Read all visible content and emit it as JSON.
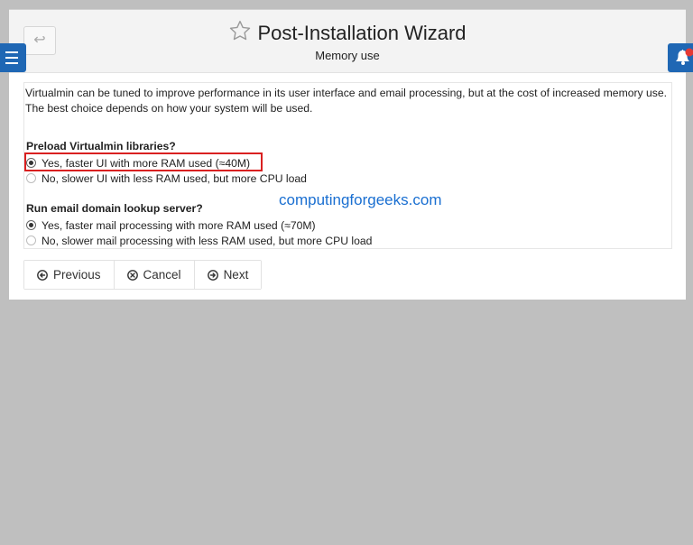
{
  "header": {
    "title": "Post-Installation Wizard",
    "subtitle": "Memory use",
    "back_glyph": "↩",
    "icons": [
      "star-icon",
      "back-icon",
      "menu-icon",
      "bell-icon"
    ]
  },
  "intro": "Virtualmin can be tuned to improve performance in its user interface and email processing, but at the cost of increased memory use. The best choice depends on how your system will be used.",
  "questions": [
    {
      "label": "Preload Virtualmin libraries?",
      "options": [
        {
          "label": "Yes, faster UI with more RAM used (≈40M)",
          "selected": true
        },
        {
          "label": "No, slower UI with less RAM used, but more CPU load",
          "selected": false
        }
      ]
    },
    {
      "label": "Run email domain lookup server?",
      "options": [
        {
          "label": "Yes, faster mail processing with more RAM used (≈70M)",
          "selected": true
        },
        {
          "label": "No, slower mail processing with less RAM used, but more CPU load",
          "selected": false
        }
      ]
    }
  ],
  "watermark": "computingforgeeks.com",
  "buttons": {
    "previous": "Previous",
    "cancel": "Cancel",
    "next": "Next"
  },
  "colors": {
    "accent": "#1f67b4",
    "highlight": "#d92020",
    "watermark": "#1a6fd1",
    "background": "#bfbfbf"
  }
}
